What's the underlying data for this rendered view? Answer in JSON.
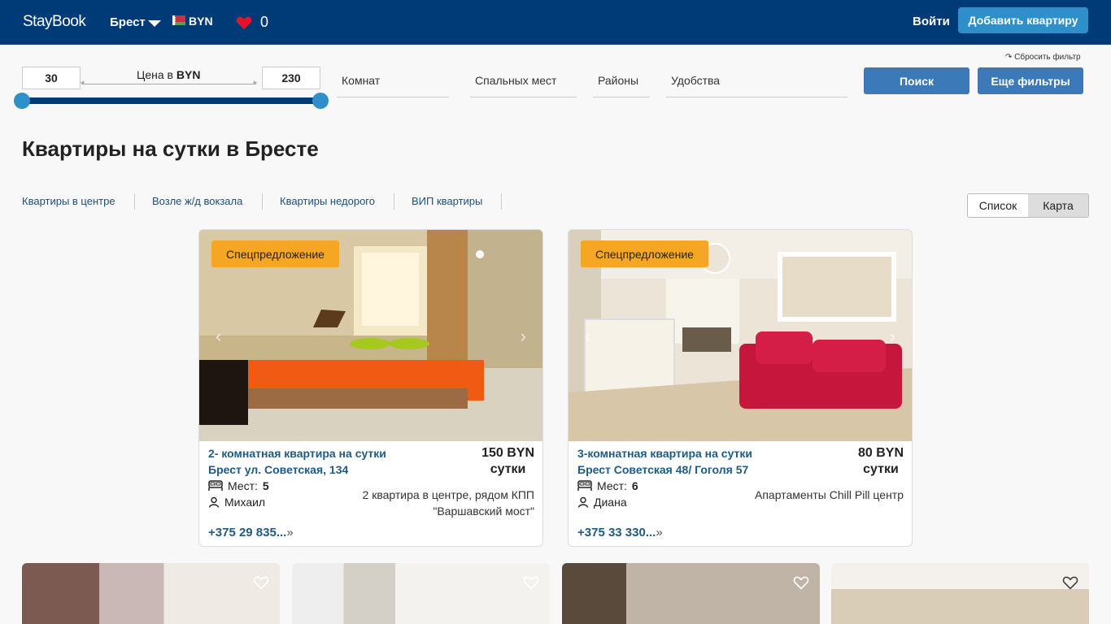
{
  "header": {
    "logo": "StayBook",
    "city": "Брест",
    "currency": "BYN",
    "favorites_count": "0",
    "login": "Войти",
    "add_button": "Добавить квартиру"
  },
  "filters": {
    "price_min": "30",
    "price_max": "230",
    "price_label_prefix": "Цена в ",
    "price_label_currency": "BYN",
    "rooms": "Комнат",
    "beds": "Спальных мест",
    "districts": "Районы",
    "amenities": "Удобства",
    "reset": "↷ Сбросить фильтр",
    "search_button": "Поиск",
    "more_filters_button": "Еще фильтры"
  },
  "page_title": "Квартиры на сутки в Бресте",
  "quick_links": [
    "Квартиры в центре",
    "Возле ж/д вокзала",
    "Квартиры недорого",
    "ВИП квартиры"
  ],
  "view_toggle": {
    "list": "Список",
    "map": "Карта"
  },
  "listings": [
    {
      "badge": "Спецпредложение",
      "title": "2- комнатная квартира на сутки",
      "address": "Брест ул. Советская, 134",
      "price": "150 BYN",
      "price_unit": "сутки",
      "seats_label": "Мест:",
      "seats": "5",
      "owner": "Михаил",
      "description_line1": "2 квартира в центре, рядом КПП",
      "description_line2": "\"Варшавский мост\"",
      "phone": "+375 29 835...",
      "phone_more": "»"
    },
    {
      "badge": "Спецпредложение",
      "title": "3-комнатная квартира на сутки",
      "address": "Брест Советская 48/ Гоголя 57",
      "price": "80 BYN",
      "price_unit": "сутки",
      "seats_label": "Мест:",
      "seats": "6",
      "owner": "Диана",
      "description_line1": "Апартаменты Chill Pill центр",
      "description_line2": "",
      "phone": "+375 33 330...",
      "phone_more": "»"
    }
  ],
  "colors": {
    "header_bg": "#003b78",
    "accent": "#2f8fc9",
    "button_blue": "#3b79b8",
    "badge": "#f5a623",
    "link": "#1e5b86"
  }
}
